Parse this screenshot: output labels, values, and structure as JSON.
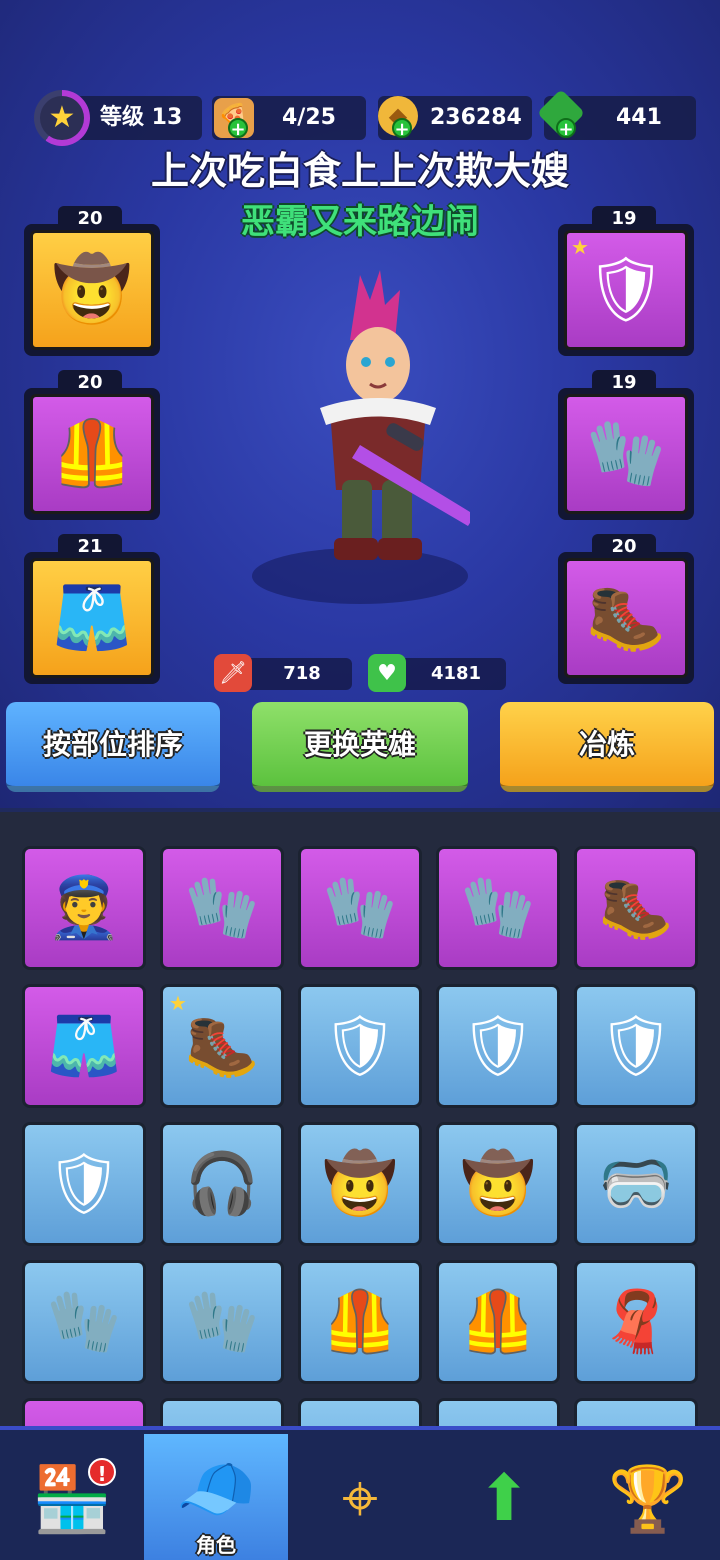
{
  "header": {
    "level_label": "等级 13",
    "level_icon": "star-icon",
    "energy": "4/25",
    "coins": "236284",
    "gems": "441",
    "title": "上次吃白食上上次欺大嫂",
    "subtitle": "恶霸又来路边闹"
  },
  "equipment_left": [
    {
      "level": "20",
      "rarity": "gold",
      "glyph": "🤠",
      "icon": "cowboy-hat-icon"
    },
    {
      "level": "20",
      "rarity": "purple",
      "glyph": "🦺",
      "icon": "armor-vest-icon"
    },
    {
      "level": "21",
      "rarity": "gold",
      "glyph": "🩳",
      "icon": "pants-icon"
    }
  ],
  "equipment_right": [
    {
      "level": "19",
      "rarity": "purple",
      "glyph": "🛡",
      "icon": "shoulder-pad-icon",
      "star": true
    },
    {
      "level": "19",
      "rarity": "purple",
      "glyph": "🧤",
      "icon": "glove-icon"
    },
    {
      "level": "20",
      "rarity": "purple",
      "glyph": "🥾",
      "icon": "boot-icon"
    }
  ],
  "stats": {
    "attack": "718",
    "health": "4181"
  },
  "buttons": {
    "sort": "按部位排序",
    "change_hero": "更换英雄",
    "smelt": "冶炼"
  },
  "inventory": [
    {
      "rarity": "purple",
      "glyph": "👮",
      "icon": "police-cap-icon"
    },
    {
      "rarity": "purple",
      "glyph": "🧤",
      "icon": "glove-icon"
    },
    {
      "rarity": "purple",
      "glyph": "🧤",
      "icon": "glove-icon"
    },
    {
      "rarity": "purple",
      "glyph": "🧤",
      "icon": "glove-icon"
    },
    {
      "rarity": "purple",
      "glyph": "🥾",
      "icon": "boot-icon"
    },
    {
      "rarity": "purple",
      "glyph": "🩳",
      "icon": "shorts-icon"
    },
    {
      "rarity": "blue",
      "glyph": "🥾",
      "icon": "boot-icon",
      "star": true
    },
    {
      "rarity": "blue",
      "glyph": "🛡",
      "icon": "shoulder-pad-icon"
    },
    {
      "rarity": "blue",
      "glyph": "🛡",
      "icon": "shoulder-pad-icon"
    },
    {
      "rarity": "blue",
      "glyph": "🛡",
      "icon": "shoulder-pad-icon"
    },
    {
      "rarity": "blue",
      "glyph": "🛡",
      "icon": "shoulder-pad-icon"
    },
    {
      "rarity": "blue",
      "glyph": "🎧",
      "icon": "headphones-icon"
    },
    {
      "rarity": "blue",
      "glyph": "🤠",
      "icon": "cowboy-hat-icon"
    },
    {
      "rarity": "blue",
      "glyph": "🤠",
      "icon": "cowboy-hat-icon"
    },
    {
      "rarity": "blue",
      "glyph": "🥽",
      "icon": "goggles-icon"
    },
    {
      "rarity": "blue",
      "glyph": "🧤",
      "icon": "glove-icon"
    },
    {
      "rarity": "blue",
      "glyph": "🧤",
      "icon": "glove-icon"
    },
    {
      "rarity": "blue",
      "glyph": "🦺",
      "icon": "vest-icon"
    },
    {
      "rarity": "blue",
      "glyph": "🦺",
      "icon": "vest-icon"
    },
    {
      "rarity": "blue",
      "glyph": "🧣",
      "icon": "scarf-icon"
    }
  ],
  "nav": {
    "shop_icon": "shop-icon",
    "hero_label": "角色",
    "target_icon": "crosshair-icon",
    "upgrade_icon": "upgrade-icon",
    "trophy_icon": "trophy-icon"
  }
}
